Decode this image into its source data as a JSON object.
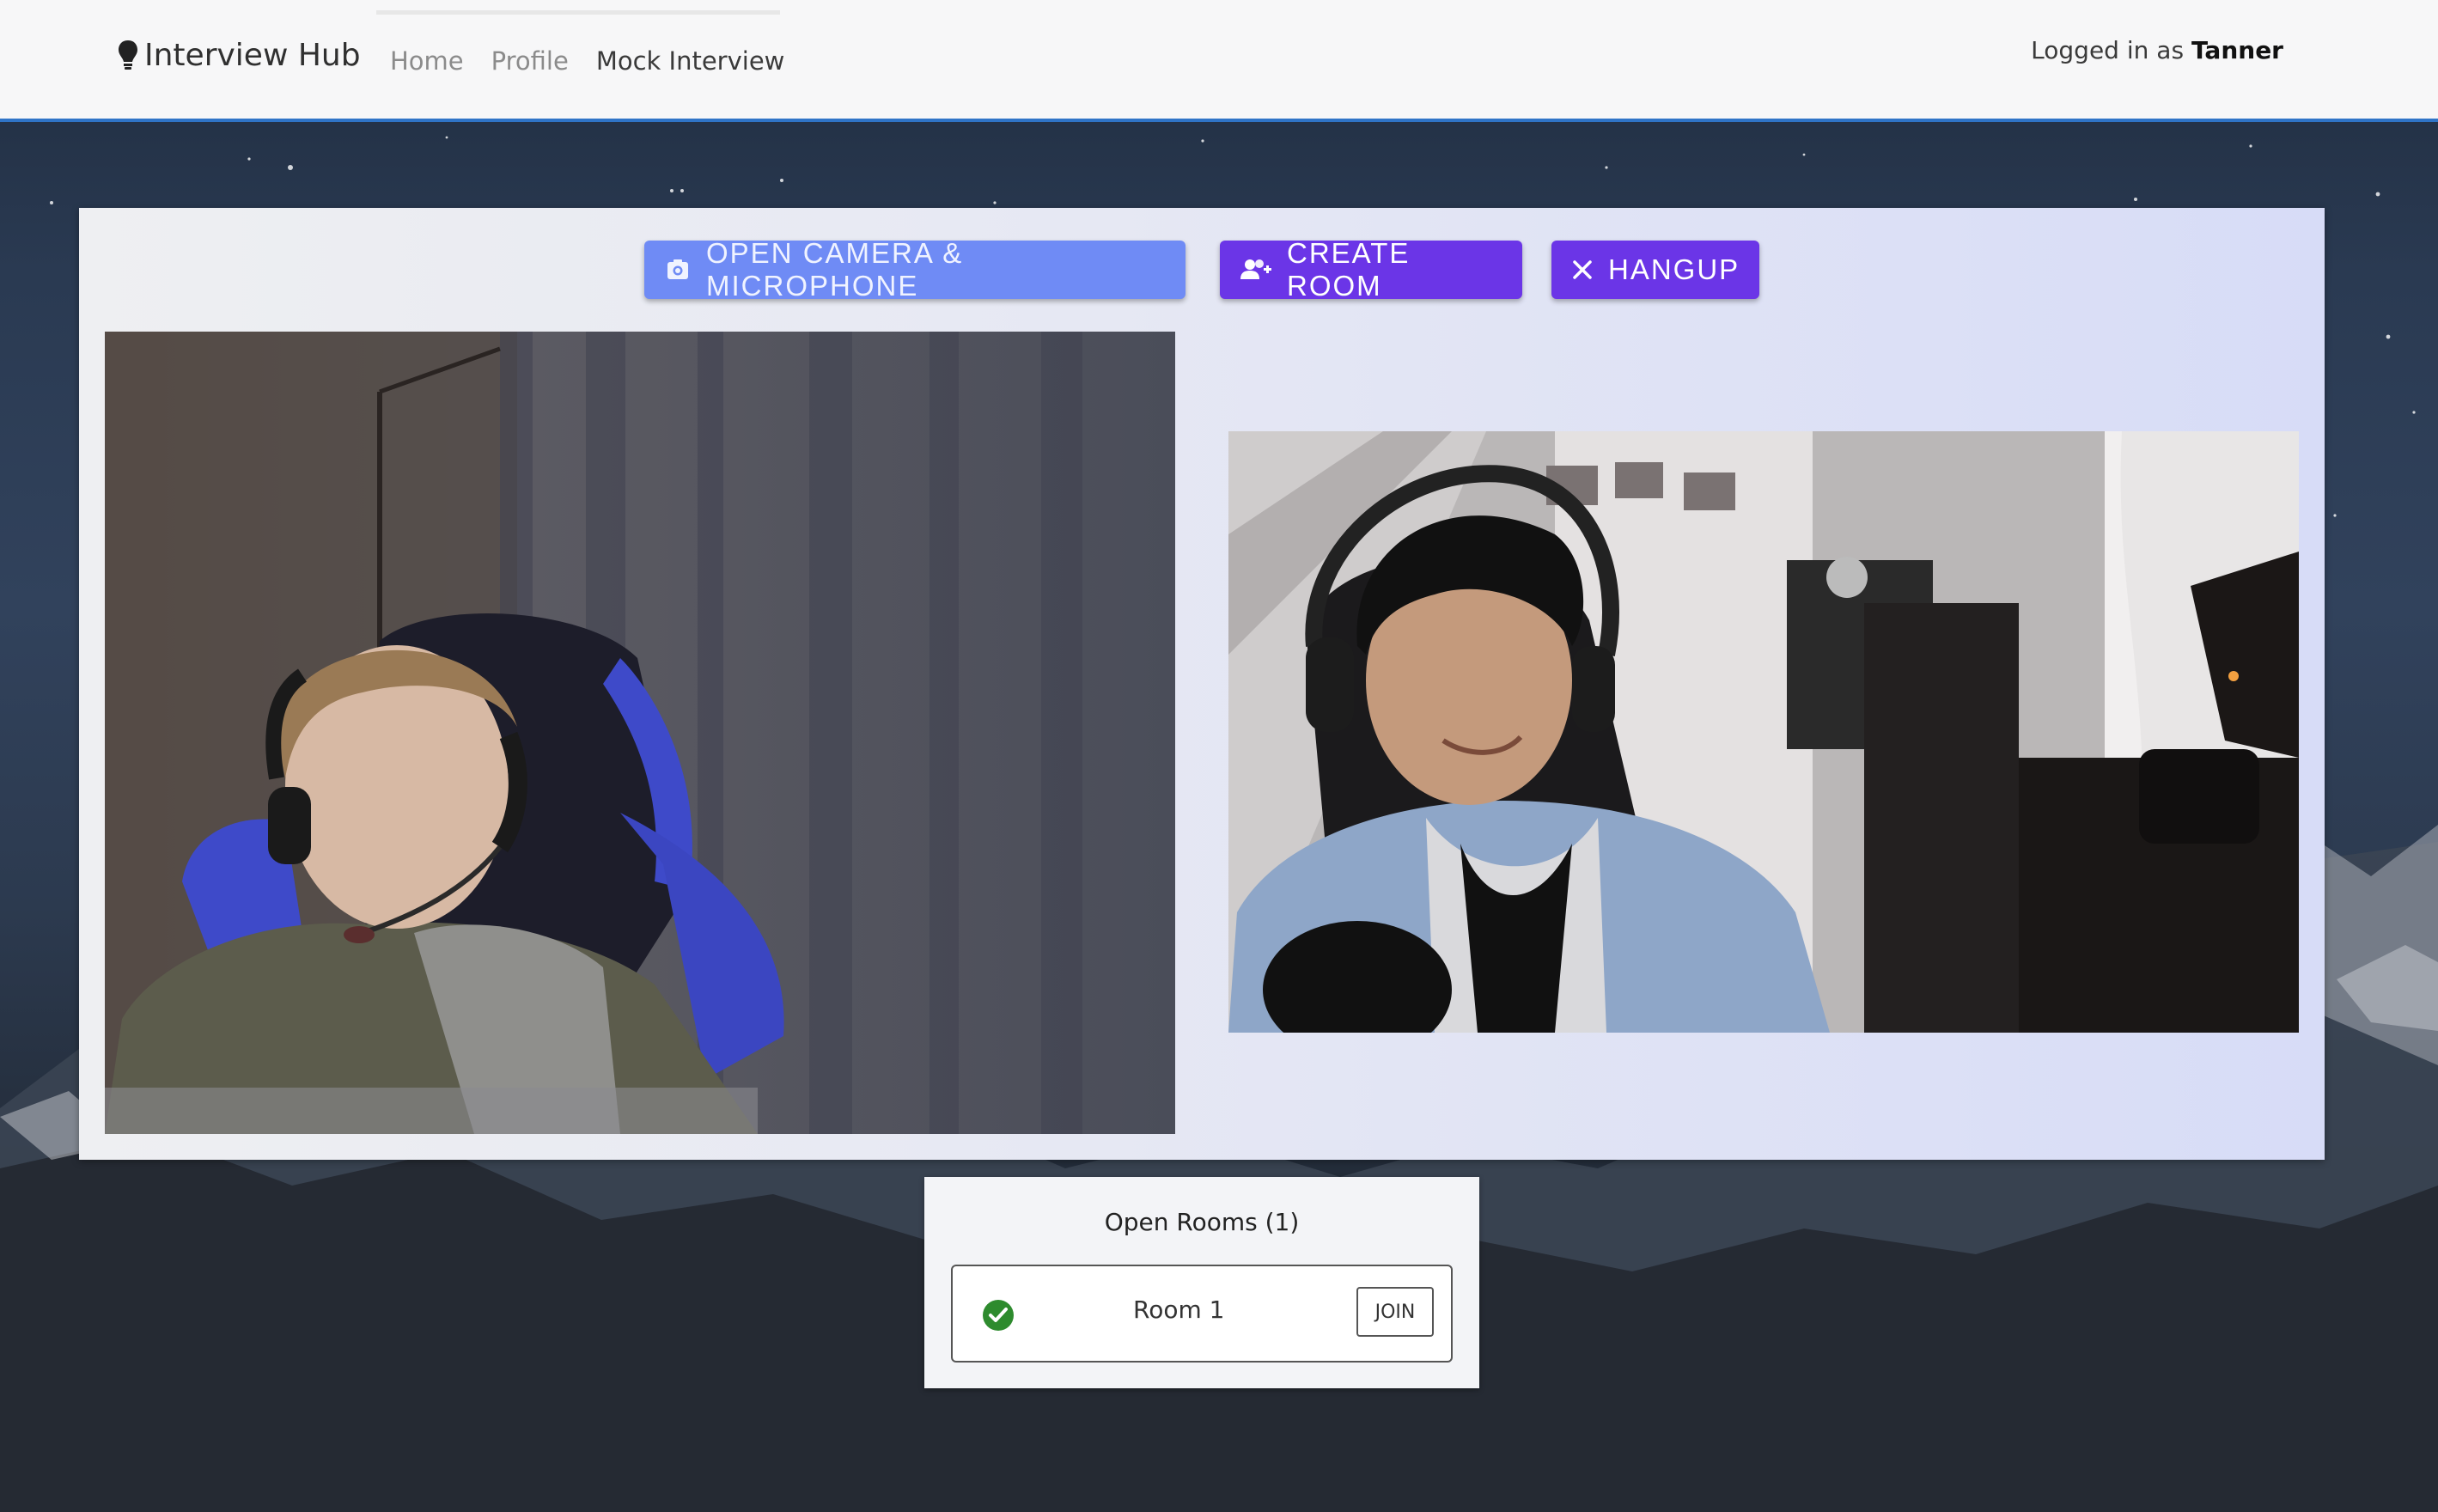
{
  "app": {
    "brand": "Interview Hub",
    "brand_icon": "lightbulb-icon"
  },
  "nav": {
    "links": [
      {
        "label": "Home",
        "active": false
      },
      {
        "label": "Profile",
        "active": false
      },
      {
        "label": "Mock Interview",
        "active": true
      }
    ],
    "login_prefix": "Logged in as",
    "username": "Tanner"
  },
  "controls": {
    "open_camera": {
      "label": "OPEN CAMERA & MICROPHONE",
      "icon": "camera-icon"
    },
    "create_room": {
      "label": "CREATE ROOM",
      "icon": "add-group-icon"
    },
    "hangup": {
      "label": "HANGUP",
      "icon": "close-icon"
    }
  },
  "rooms": {
    "title": "Open Rooms (1)",
    "items": [
      {
        "name": "Room 1",
        "status_icon": "check-circle-icon",
        "join_label": "JOIN"
      }
    ]
  },
  "colors": {
    "accent": "#6b35e7",
    "camera_button": "#6f8bf5",
    "nav_border": "#2f74c7",
    "status_ok": "#2e8b2e"
  }
}
